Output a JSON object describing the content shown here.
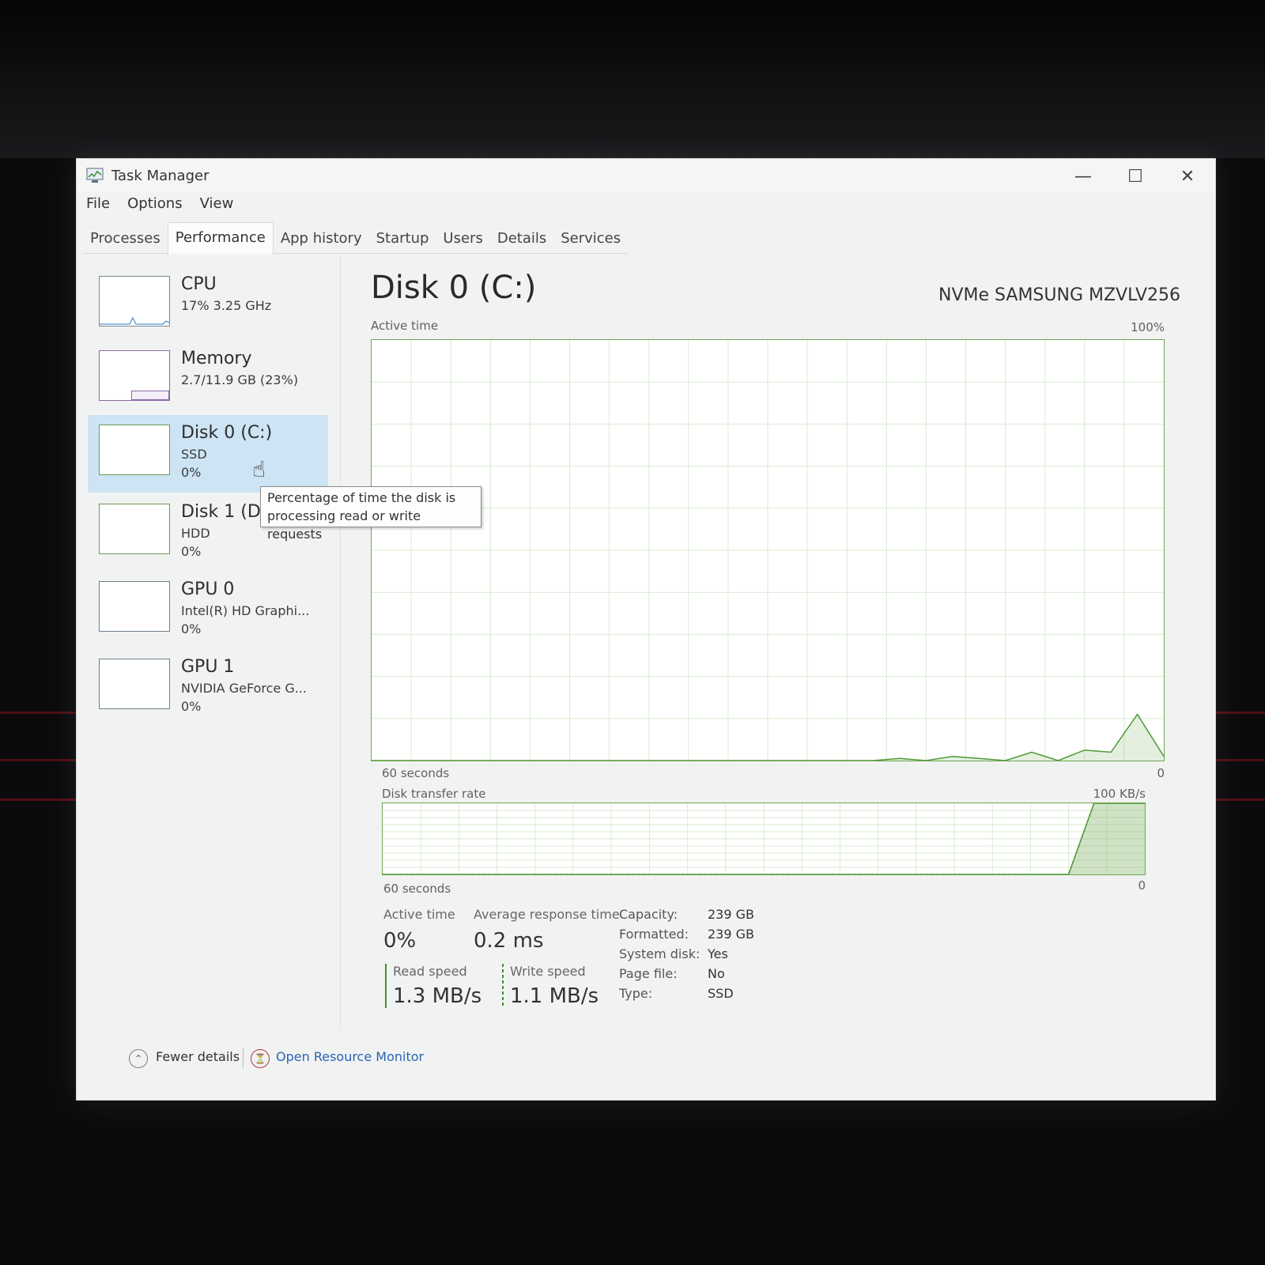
{
  "window": {
    "title": "Task Manager"
  },
  "menu": [
    "File",
    "Options",
    "View"
  ],
  "tabs": [
    {
      "label": "Processes",
      "active": false
    },
    {
      "label": "Performance",
      "active": true
    },
    {
      "label": "App history",
      "active": false
    },
    {
      "label": "Startup",
      "active": false
    },
    {
      "label": "Users",
      "active": false
    },
    {
      "label": "Details",
      "active": false
    },
    {
      "label": "Services",
      "active": false
    }
  ],
  "resources": [
    {
      "name": "CPU",
      "sub": "17% 3.25 GHz",
      "sub2": ""
    },
    {
      "name": "Memory",
      "sub": "2.7/11.9 GB (23%)",
      "sub2": ""
    },
    {
      "name": "Disk 0 (C:)",
      "sub": "SSD",
      "sub2": "0%"
    },
    {
      "name": "Disk 1 (D",
      "sub": "HDD",
      "sub2": "0%"
    },
    {
      "name": "GPU 0",
      "sub": "Intel(R) HD Graphi...",
      "sub2": "0%"
    },
    {
      "name": "GPU 1",
      "sub": "NVIDIA GeForce G...",
      "sub2": "0%"
    }
  ],
  "tooltip": [
    "Percentage of time the disk is",
    "processing read or write requests"
  ],
  "main": {
    "title": "Disk 0 (C:)",
    "device": "NVMe SAMSUNG MZVLV256",
    "graph1": {
      "label": "Active time",
      "max": "100%",
      "time": "60 seconds",
      "min": "0"
    },
    "graph2": {
      "label": "Disk transfer rate",
      "max": "100 KB/s",
      "time": "60 seconds",
      "min": "0"
    }
  },
  "stats": {
    "active_time_label": "Active time",
    "active_time": "0%",
    "avg_resp_label": "Average response time",
    "avg_resp": "0.2 ms",
    "read_label": "Read speed",
    "read": "1.3 MB/s",
    "write_label": "Write speed",
    "write": "1.1 MB/s"
  },
  "properties": [
    {
      "k": "Capacity:",
      "v": "239 GB"
    },
    {
      "k": "Formatted:",
      "v": "239 GB"
    },
    {
      "k": "System disk:",
      "v": "Yes"
    },
    {
      "k": "Page file:",
      "v": "No"
    },
    {
      "k": "Type:",
      "v": "SSD"
    }
  ],
  "footer": {
    "fewer": "Fewer details",
    "monitor": "Open Resource Monitor"
  },
  "chart_data": [
    {
      "type": "area",
      "title": "Active time",
      "xlabel": "60 seconds",
      "ylim": [
        0,
        100
      ],
      "x": [
        0,
        2,
        4,
        6,
        8,
        10,
        12,
        14,
        16,
        18,
        20,
        22,
        24,
        26,
        28,
        30,
        32,
        34,
        36,
        38,
        40,
        42,
        44,
        46,
        48,
        50,
        52,
        54,
        56,
        58,
        60
      ],
      "series": [
        {
          "name": "Active time",
          "values": [
            0,
            0,
            0,
            0,
            0,
            0,
            0,
            0,
            0,
            0,
            0,
            0,
            0,
            0,
            0,
            0,
            0,
            0,
            0,
            0,
            0.5,
            0,
            1,
            0.5,
            0,
            2,
            0,
            2.5,
            2,
            11,
            1
          ]
        }
      ]
    },
    {
      "type": "area",
      "title": "Disk transfer rate",
      "xlabel": "60 seconds",
      "ylim": [
        0,
        100
      ],
      "x": [
        0,
        2,
        4,
        6,
        8,
        10,
        12,
        14,
        16,
        18,
        20,
        22,
        24,
        26,
        28,
        30,
        32,
        34,
        36,
        38,
        40,
        42,
        44,
        46,
        48,
        50,
        52,
        54,
        56,
        58,
        60
      ],
      "series": [
        {
          "name": "Read speed",
          "values": [
            0,
            0,
            0,
            0,
            0,
            0,
            0,
            0,
            0,
            0,
            0,
            0,
            0,
            0,
            0,
            0,
            0,
            0,
            0,
            0,
            0,
            0,
            0,
            0,
            0,
            0,
            0,
            0,
            100,
            100,
            100
          ]
        },
        {
          "name": "Write speed",
          "values": [
            0,
            0,
            0,
            0,
            0,
            0,
            0,
            0,
            0,
            0,
            0,
            0,
            0,
            0,
            0,
            0,
            0,
            0,
            0,
            0,
            0,
            0,
            0,
            0,
            0,
            0,
            0,
            0,
            100,
            100,
            100
          ]
        }
      ]
    }
  ]
}
